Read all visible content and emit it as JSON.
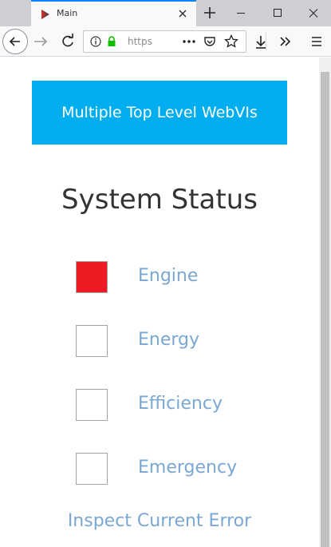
{
  "browser": {
    "tab_title": "Main",
    "url": "https"
  },
  "page": {
    "banner_text": "Multiple Top Level WebVIs",
    "title": "System Status",
    "statuses": [
      {
        "label": "Engine",
        "color": "#ed1c24"
      },
      {
        "label": "Energy",
        "color": "#ffffff"
      },
      {
        "label": "Efficiency",
        "color": "#ffffff"
      },
      {
        "label": "Emergency",
        "color": "#ffffff"
      }
    ],
    "inspect_link": "Inspect Current Error"
  },
  "colors": {
    "banner": "#00adef",
    "link": "#7aa7d3",
    "active_indicator": "#ed1c24"
  }
}
